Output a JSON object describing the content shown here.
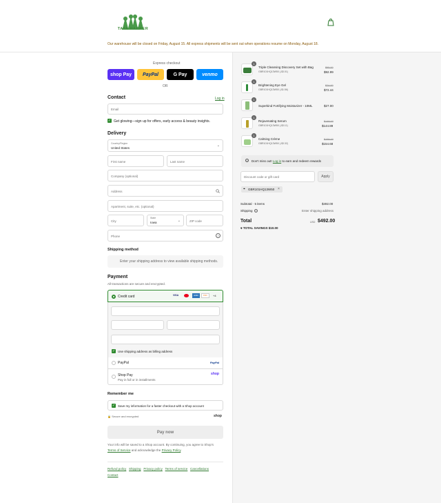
{
  "header": {
    "brand": "TATA HARPER",
    "cart_icon": "bag-icon",
    "banner": "Our warehouse will be closed on Friday, August 15. All express shipments will be sent out when operations resume on Monday, August 18."
  },
  "express": {
    "title": "Express checkout",
    "shop_pay": "shop Pay",
    "paypal": "PayPal",
    "gpay": "G Pay",
    "venmo": "venmo",
    "or": "OR"
  },
  "contact": {
    "title": "Contact",
    "login": "Log in",
    "email_placeholder": "Email",
    "newsletter": "Get glowing—sign up for offers, early access & beauty insights."
  },
  "delivery": {
    "title": "Delivery",
    "country_label": "Country/Region",
    "country": "United States",
    "first_name": "First name",
    "last_name": "Last name",
    "company": "Company (optional)",
    "address": "Address",
    "apartment": "Apartment, suite, etc. (optional)",
    "city": "City",
    "state_label": "State",
    "state": "Iowa",
    "zip": "ZIP code",
    "phone": "Phone"
  },
  "shipping_method": {
    "title": "Shipping method",
    "message": "Enter your shipping address to view available shipping methods."
  },
  "payment": {
    "title": "Payment",
    "subtitle": "All transactions are secure and encrypted.",
    "credit_card": "Credit card",
    "cards": [
      "VISA",
      "MC",
      "AMEX",
      "DISC",
      "+4"
    ],
    "billing_same": "Use shipping address as billing address",
    "paypal": "PayPal",
    "paypal_logo": "PayPal",
    "shop_pay": "Shop Pay",
    "shop_pay_sub": "Pay in full or in installments",
    "shop_logo": "shop"
  },
  "remember": {
    "title": "Remember me",
    "save": "Save my information for a faster checkout with a Shop account",
    "secure": "Secure and encrypted",
    "shop": "shop"
  },
  "pay_now": "Pay now",
  "legal": {
    "text1": "Your info will be saved to a Shop account. By continuing, you agree to Shop's",
    "terms": "Terms of Service",
    "text2": "and acknowledge the",
    "privacy": "Privacy Policy",
    "end": "."
  },
  "footer_links": [
    "Refund policy",
    "Shipping",
    "Privacy policy",
    "Terms of service",
    "Cancellations",
    "Contact"
  ],
  "order": {
    "items": [
      {
        "qty": "1",
        "name": "Triple Cleansing Discovery Set with Bag",
        "code": "GBR101HQ13W50 (-$3.01)",
        "was": "$95.00",
        "price": "$92.99"
      },
      {
        "qty": "1",
        "name": "Brightening Eye Gel",
        "code": "GBR101HQ13W50 (-$1.56)",
        "was": "$74.00",
        "price": "$72.44"
      },
      {
        "qty": "1",
        "name": "Superkind Fortifying Moisturizer - 10ML",
        "code": "",
        "was": "",
        "price": "$27.00"
      },
      {
        "qty": "1",
        "name": "Rejuvenating Serum",
        "code": "GBR101HQ13W50 (-$3.11)",
        "was": "$148.00",
        "price": "$144.89"
      },
      {
        "qty": "1",
        "name": "Calming Crème",
        "code": "GBR101HQ13W50 (-$3.32)",
        "was": "$158.00",
        "price": "$154.68"
      }
    ],
    "rewards_pre": "Don't miss out!",
    "rewards_link": "Log in",
    "rewards_post": "to earn and redeem rewards",
    "discount_placeholder": "Discount code or gift card",
    "apply": "Apply",
    "applied_code": "GBR101HQ13W50",
    "subtotal_label": "Subtotal · 5 items",
    "subtotal": "$492.00",
    "shipping_label": "Shipping",
    "shipping_value": "Enter shipping address",
    "total_label": "Total",
    "currency": "USD",
    "total": "$492.00",
    "savings_label": "TOTAL SAVINGS",
    "savings": "$10.00"
  }
}
